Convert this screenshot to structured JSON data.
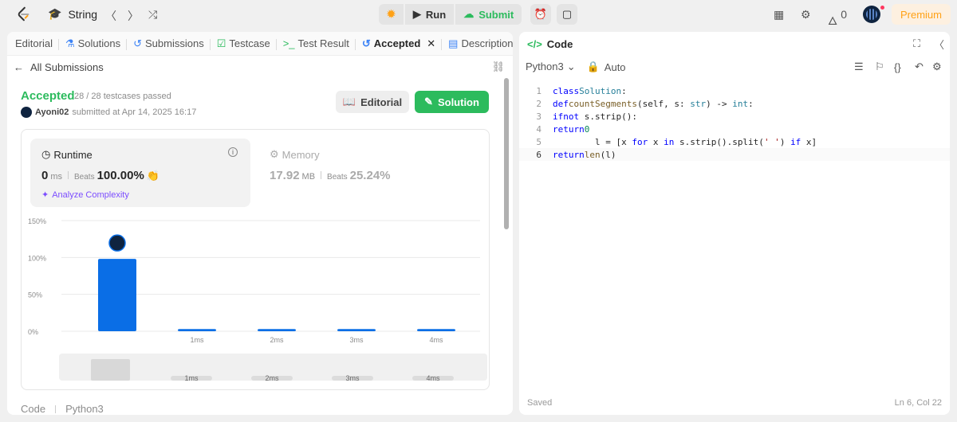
{
  "topbar": {
    "problem_list": "String",
    "run_label": "Run",
    "submit_label": "Submit",
    "premium_label": "Premium",
    "streak_count": "0",
    "colors": {
      "submit": "#2cbb5d",
      "premium": "#ffa116",
      "accent": "#2cbb5d"
    }
  },
  "left": {
    "tabs": [
      {
        "label": "Editorial",
        "icon": "book-icon"
      },
      {
        "label": "Solutions",
        "icon": "flask-icon"
      },
      {
        "label": "Submissions",
        "icon": "history-icon"
      },
      {
        "label": "Testcase",
        "icon": "checkbox-icon"
      },
      {
        "label": "Test Result",
        "icon": "terminal-icon"
      },
      {
        "label": "Accepted",
        "icon": "history-icon"
      },
      {
        "label": "Description",
        "icon": "document-icon"
      }
    ],
    "back_label": "All Submissions",
    "status": "Accepted",
    "testcases": "28 / 28 testcases passed",
    "username": "Ayoni02",
    "submitted_at": "submitted at Apr 14, 2025 16:17",
    "editorial_btn": "Editorial",
    "solution_btn": "Solution",
    "runtime": {
      "label": "Runtime",
      "value": "0",
      "unit": "ms",
      "beats_label": "Beats",
      "beats": "100.00%"
    },
    "analyze_label": "Analyze Complexity",
    "memory": {
      "label": "Memory",
      "value": "17.92",
      "unit": "MB",
      "beats_label": "Beats",
      "beats": "25.24%"
    },
    "footer": {
      "code_label": "Code",
      "lang": "Python3"
    }
  },
  "chart_data": {
    "type": "bar",
    "categories": [
      "",
      "1ms",
      "2ms",
      "3ms",
      "4ms"
    ],
    "values": [
      98,
      3,
      3,
      3,
      3
    ],
    "ylabel": "",
    "yticks": [
      "0%",
      "50%",
      "100%",
      "150%"
    ],
    "ylim": [
      0,
      150
    ],
    "grid": true,
    "highlight_index": 0,
    "colors": {
      "bar": "#0a6ee6"
    },
    "navigator_labels": [
      "1ms",
      "2ms",
      "3ms",
      "4ms"
    ]
  },
  "right": {
    "title": "Code",
    "language": "Python3",
    "mode": "Auto",
    "status": "Saved",
    "position": "Ln 6, Col 22",
    "code_lines": [
      "class Solution:",
      "    def countSegments(self, s: str) -> int:",
      "        if not s.strip():",
      "            return 0",
      "        l = [x for x in s.strip().split(' ') if x]",
      "        return len(l)"
    ]
  }
}
